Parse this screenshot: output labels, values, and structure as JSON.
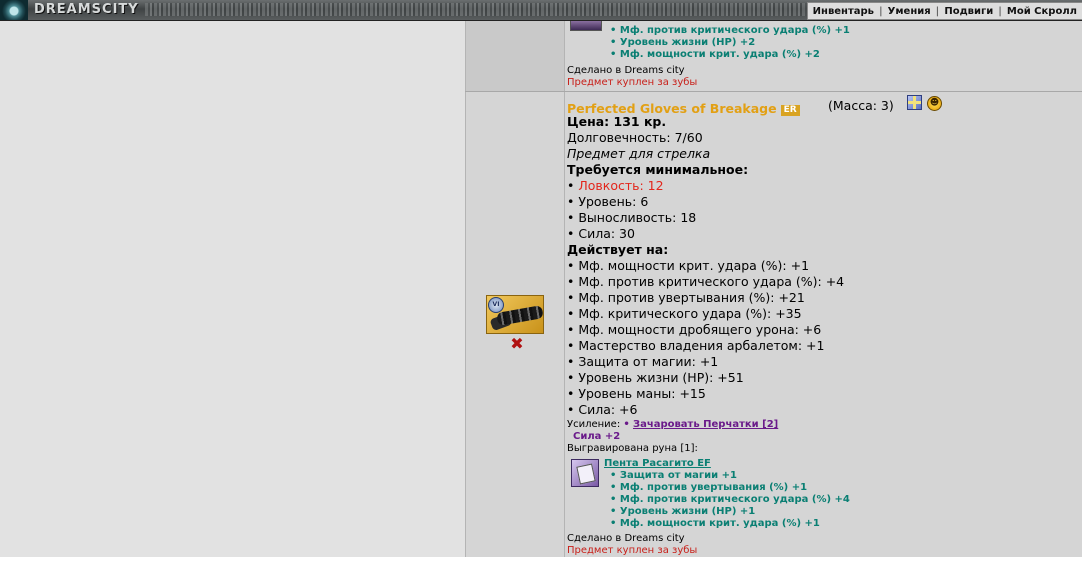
{
  "header": {
    "logo_text": "DREAMSCITY",
    "nav": [
      "Инвентарь",
      "Умения",
      "Подвиги",
      "Мой Скролл"
    ]
  },
  "prev_item": {
    "bonuses": [
      "• Мф. против критического удара (%) +1",
      "• Уровень жизни (HP) +2",
      "• Мф. мощности крит. удара (%) +2"
    ],
    "made_in": "Сделано в Dreams city",
    "bought": "Предмет куплен за зубы"
  },
  "item": {
    "title": "Perfected Gloves of Breakage",
    "badge": "ER",
    "mass": "(Масса: 3)",
    "price_label": "Цена: 131 кр.",
    "durability": "Долговечность: 7/60",
    "class_note": "Предмет для стрелка",
    "requires_header": "Требуется минимальное:",
    "requirements": [
      {
        "text": "Ловкость: 12",
        "unmet": true
      },
      {
        "text": "Уровень: 6",
        "unmet": false
      },
      {
        "text": "Выносливость: 18",
        "unmet": false
      },
      {
        "text": "Сила: 30",
        "unmet": false
      }
    ],
    "effects_header": "Действует на:",
    "effects": [
      "Мф. мощности крит. удара (%): +1",
      "Мф. против критического удара (%): +4",
      "Мф. против увертывания (%): +21",
      "Мф. критического удара (%): +35",
      "Мф. мощности дробящего урона: +6",
      "Мастерство владения арбалетом: +1",
      "Защита от магии: +1",
      "Уровень жизни (HP): +51",
      "Уровень маны: +15",
      "Сила: +6"
    ],
    "enhance_label": "Усиление:",
    "enhance_link": "Зачаровать Перчатки [2]",
    "enhance_bonus": "Сила +2",
    "rune_label": "Выгравирована руна [1]:",
    "rune_name": "Пента Расагито EF",
    "rune_bonuses": [
      "• Защита от магии +1",
      "• Мф. против увертывания (%) +1",
      "• Мф. против критического удара (%) +4",
      "• Уровень жизни (HP) +1",
      "• Мф. мощности крит. удара (%) +1"
    ],
    "made_in": "Сделано в Dreams city",
    "bought": "Предмет куплен за зубы",
    "image_badge": "VI",
    "colors": {
      "title": "#e2a014",
      "unmet": "#e3261c",
      "teal": "#0a7f73",
      "purple": "#6a1a8a"
    }
  }
}
